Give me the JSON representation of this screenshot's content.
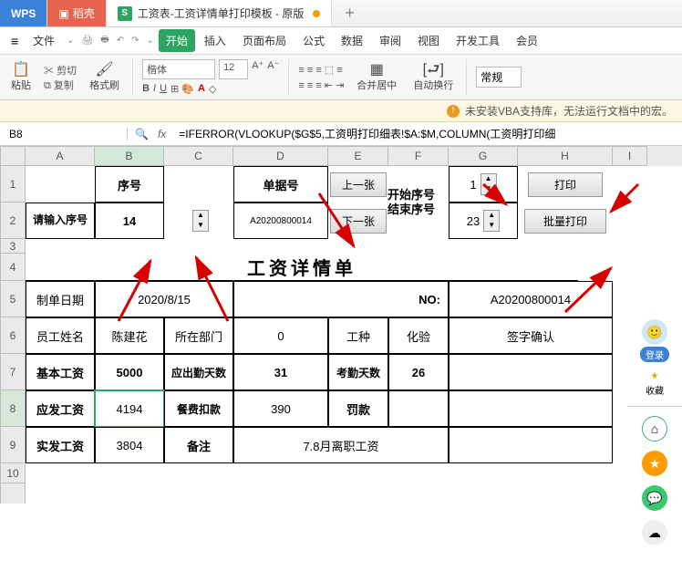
{
  "titlebar": {
    "wps": "WPS",
    "daoke": "稻壳",
    "doc": "工资表-工资详情单打印模板 - 原版",
    "doc_icon": "S",
    "plus": "+"
  },
  "menu": {
    "hamburger": "≡",
    "file": "文件",
    "begin": "开始",
    "insert": "插入",
    "layout": "页面布局",
    "formula": "公式",
    "data": "数据",
    "review": "审阅",
    "view": "视图",
    "dev": "开发工具",
    "member": "会员"
  },
  "ribbon": {
    "paste": "粘贴",
    "cut": "剪切",
    "copy": "复制",
    "format_painter": "格式刷",
    "font_family": "楷体",
    "font_size": "12",
    "merge": "合并居中",
    "wrap": "自动换行",
    "style": "常规"
  },
  "warning": "未安装VBA支持库，无法运行文档中的宏。",
  "namebox": "B8",
  "formula": "=IFERROR(VLOOKUP($G$5,工资明打印细表!$A:$M,COLUMN(工资明打印细",
  "cols": [
    "A",
    "B",
    "C",
    "D",
    "E",
    "F",
    "G",
    "H",
    "I"
  ],
  "r1": {
    "B": "序号",
    "D": "单据号",
    "E_btn": "上一张",
    "F": "开始序号",
    "G": "1",
    "H_btn": "打印"
  },
  "r2": {
    "A": "请输入序号",
    "B": "14",
    "D": "A20200800014",
    "E_btn": "下一张",
    "F": "结束序号",
    "G": "23",
    "H_btn": "批量打印"
  },
  "r4": {
    "title": "工资详情单"
  },
  "r5": {
    "A": "制单日期",
    "B": "2020/8/15",
    "F": "NO:",
    "H": "A20200800014"
  },
  "r6": {
    "A": "员工姓名",
    "B": "陈建花",
    "C": "所在部门",
    "D": "0",
    "E": "工种",
    "F": "化验",
    "GH": "签字确认"
  },
  "r7": {
    "A": "基本工资",
    "B": "5000",
    "C": "应出勤天数",
    "D": "31",
    "E": "考勤天数",
    "F": "26"
  },
  "r8": {
    "A": "应发工资",
    "B": "4194",
    "C": "餐费扣款",
    "D": "390",
    "E": "罚款"
  },
  "r9": {
    "A": "实发工资",
    "B": "3804",
    "C": "备注",
    "DEF": "7.8月离职工资"
  },
  "side": {
    "login": "登录",
    "fav": "收藏"
  },
  "chart_data": {
    "type": "table",
    "title": "工资详情单",
    "categories": [
      "员工姓名",
      "所在部门",
      "工种",
      "基本工资",
      "应出勤天数",
      "考勤天数",
      "应发工资",
      "餐费扣款",
      "罚款",
      "实发工资",
      "备注"
    ],
    "values": [
      "陈建花",
      "0",
      "化验",
      5000,
      31,
      26,
      4194,
      390,
      null,
      3804,
      "7.8月离职工资"
    ]
  }
}
